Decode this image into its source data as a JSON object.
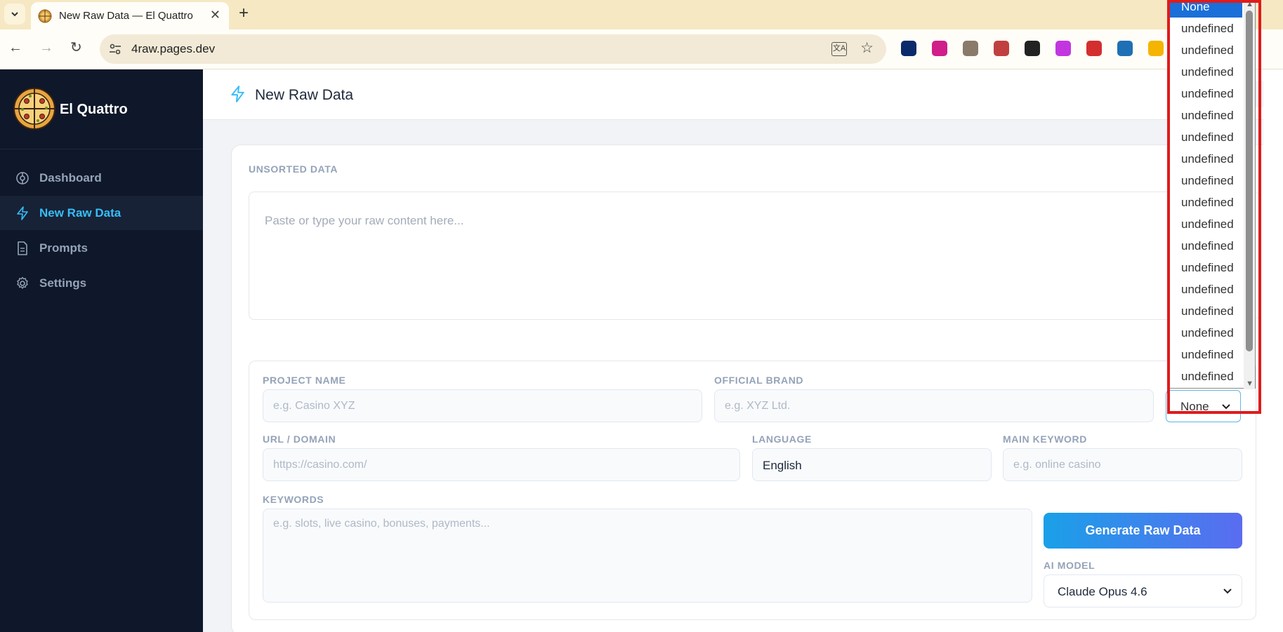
{
  "browser": {
    "tab_title": "New Raw Data — El Quattro",
    "address": "4raw.pages.dev",
    "translate_glyph": "文A",
    "extensions": [
      {
        "name": "hexagon-extension-icon",
        "color": "#0a2a6b"
      },
      {
        "name": "download-extension-icon",
        "color": "#d01e8a"
      },
      {
        "name": "feather-extension-icon",
        "color": "#8a7a6a"
      },
      {
        "name": "pen-extension-icon",
        "color": "#c04040"
      },
      {
        "name": "ninja-extension-icon",
        "color": "#222222"
      },
      {
        "name": "edit-extension-icon",
        "color": "#c236e0"
      },
      {
        "name": "seo-extension-icon",
        "color": "#d32f2f"
      },
      {
        "name": "book-extension-icon",
        "color": "#1f6fb5"
      },
      {
        "name": "lock-extension-icon",
        "color": "#f5b400"
      }
    ]
  },
  "sidebar": {
    "brand": "El Quattro",
    "items": [
      {
        "label": "Dashboard",
        "icon": "dashboard-icon"
      },
      {
        "label": "New Raw Data",
        "icon": "lightning-icon",
        "active": true
      },
      {
        "label": "Prompts",
        "icon": "document-icon"
      },
      {
        "label": "Settings",
        "icon": "gear-icon"
      }
    ]
  },
  "header": {
    "title": "New Raw Data"
  },
  "form": {
    "unsorted_label": "UNSORTED DATA",
    "unsorted_placeholder": "Paste or type your raw content here...",
    "project_name_label": "PROJECT NAME",
    "project_name_placeholder": "e.g. Casino XYZ",
    "official_brand_label": "OFFICIAL BRAND",
    "official_brand_placeholder": "e.g. XYZ Ltd.",
    "url_label": "URL / DOMAIN",
    "url_placeholder": "https://casino.com/",
    "language_label": "LANGUAGE",
    "language_value": "English",
    "main_keyword_label": "MAIN KEYWORD",
    "main_keyword_placeholder": "e.g. online casino",
    "keywords_label": "KEYWORDS",
    "keywords_placeholder": "e.g. slots, live casino, bonuses, payments...",
    "generate_button": "Generate Raw Data",
    "ai_model_label": "AI MODEL",
    "ai_model_value": "Claude Opus 4.6",
    "select_value": "None"
  },
  "dropdown": {
    "options": [
      "None",
      "undefined",
      "undefined",
      "undefined",
      "undefined",
      "undefined",
      "undefined",
      "undefined",
      "undefined",
      "undefined",
      "undefined",
      "undefined",
      "undefined",
      "undefined",
      "undefined",
      "undefined",
      "undefined",
      "undefined"
    ],
    "selected_index": 0
  },
  "colors": {
    "sidebar_bg": "#0f172a",
    "accent": "#38bdf8",
    "button_gradient_start": "#1aa0e8",
    "button_gradient_end": "#5a6cf0",
    "highlight": "#e01b1b"
  }
}
